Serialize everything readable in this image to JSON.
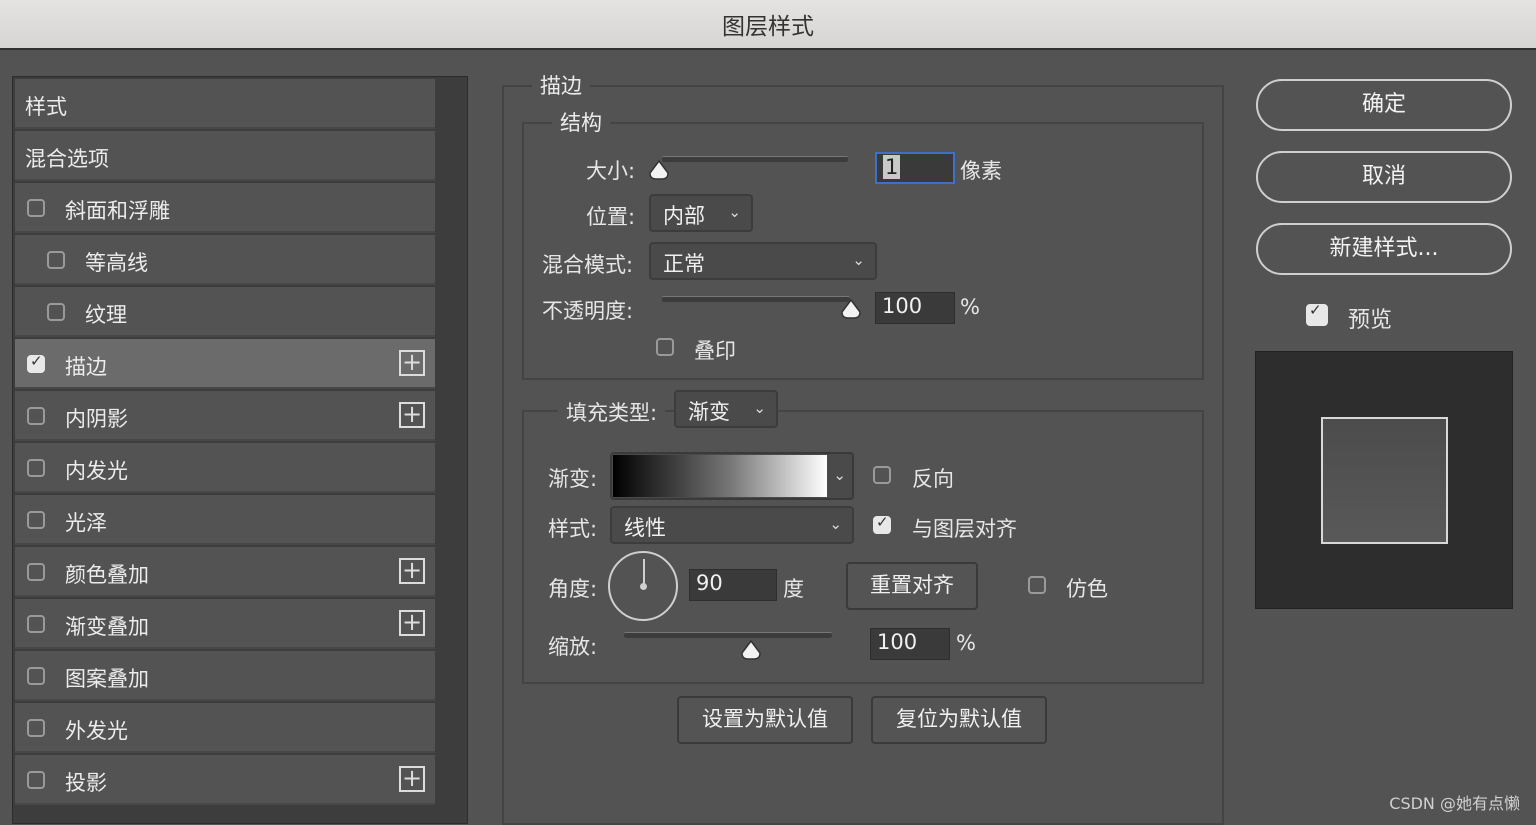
{
  "window": {
    "title": "图层样式"
  },
  "style_list": {
    "items": [
      {
        "label": "样式",
        "checkbox": false,
        "plus": false
      },
      {
        "label": "混合选项",
        "checkbox": false,
        "plus": false
      },
      {
        "label": "斜面和浮雕",
        "checkbox": true,
        "checked": false,
        "plus": false
      },
      {
        "label": "等高线",
        "checkbox": true,
        "checked": false,
        "plus": false,
        "indent": true
      },
      {
        "label": "纹理",
        "checkbox": true,
        "checked": false,
        "plus": false,
        "indent": true
      },
      {
        "label": "描边",
        "checkbox": true,
        "checked": true,
        "plus": true,
        "selected": true
      },
      {
        "label": "内阴影",
        "checkbox": true,
        "checked": false,
        "plus": true
      },
      {
        "label": "内发光",
        "checkbox": true,
        "checked": false,
        "plus": false
      },
      {
        "label": "光泽",
        "checkbox": true,
        "checked": false,
        "plus": false
      },
      {
        "label": "颜色叠加",
        "checkbox": true,
        "checked": false,
        "plus": true
      },
      {
        "label": "渐变叠加",
        "checkbox": true,
        "checked": false,
        "plus": true
      },
      {
        "label": "图案叠加",
        "checkbox": true,
        "checked": false,
        "plus": false
      },
      {
        "label": "外发光",
        "checkbox": true,
        "checked": false,
        "plus": false
      },
      {
        "label": "投影",
        "checkbox": true,
        "checked": false,
        "plus": true
      }
    ]
  },
  "stroke": {
    "legend": "描边",
    "structure": {
      "legend": "结构",
      "size_label": "大小:",
      "size_value": "1",
      "size_unit": "像素",
      "position_label": "位置:",
      "position_value": "内部",
      "blend_label": "混合模式:",
      "blend_value": "正常",
      "opacity_label": "不透明度:",
      "opacity_value": "100",
      "opacity_unit": "%",
      "overprint_label": "叠印"
    },
    "fill": {
      "type_label": "填充类型:",
      "type_value": "渐变",
      "gradient_label": "渐变:",
      "reverse_label": "反向",
      "style_label": "样式:",
      "style_value": "线性",
      "align_label": "与图层对齐",
      "angle_label": "角度:",
      "angle_value": "90",
      "angle_unit": "度",
      "reset_align_button": "重置对齐",
      "dither_label": "仿色",
      "scale_label": "缩放:",
      "scale_value": "100",
      "scale_unit": "%"
    },
    "set_default_button": "设置为默认值",
    "reset_default_button": "复位为默认值"
  },
  "actions": {
    "ok": "确定",
    "cancel": "取消",
    "new_style": "新建样式...",
    "preview_label": "预览"
  },
  "watermark": "CSDN @她有点懒"
}
